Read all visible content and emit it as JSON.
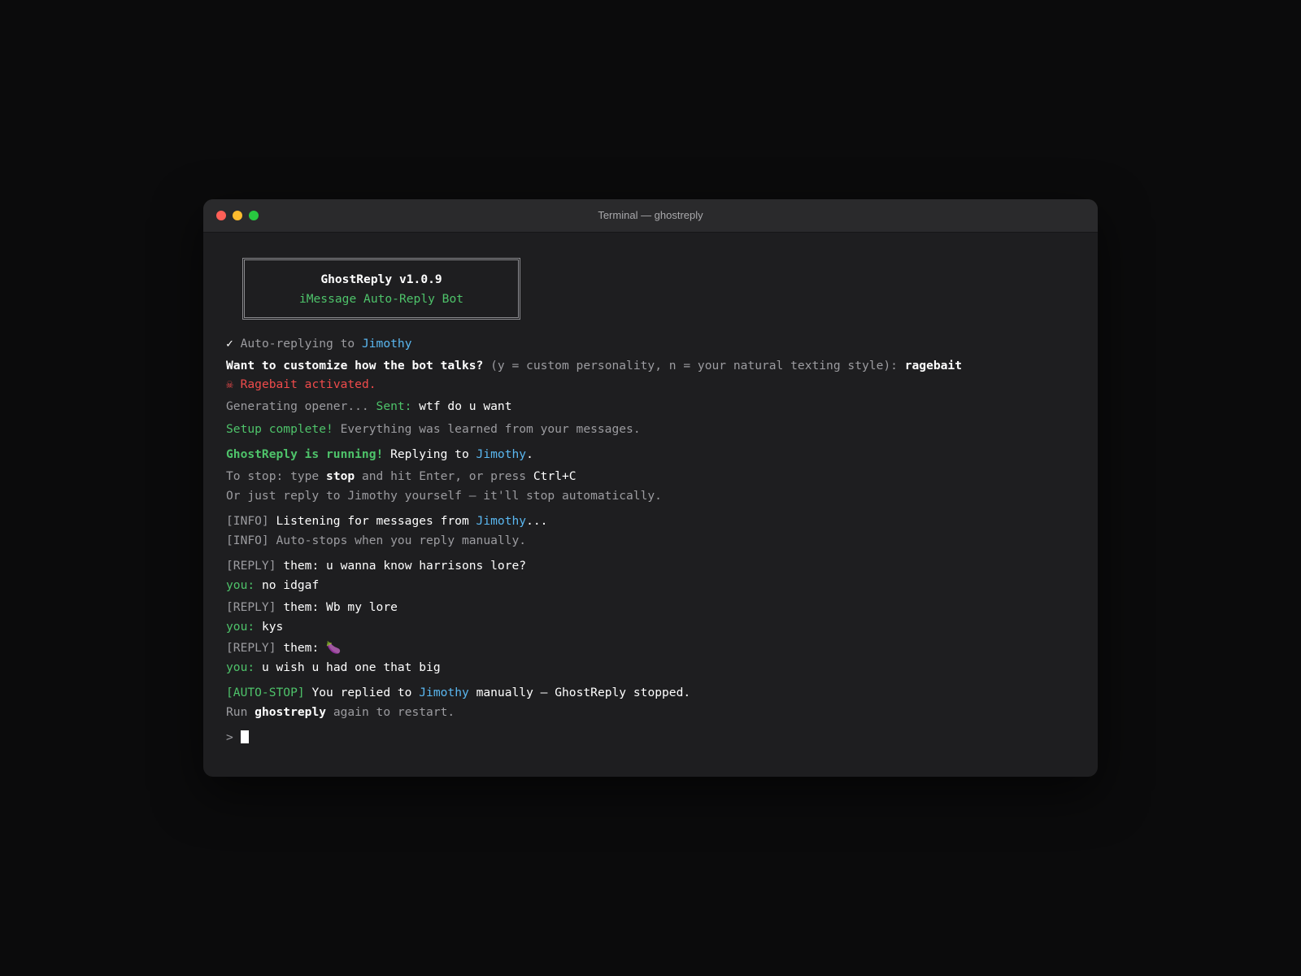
{
  "window": {
    "title": "Terminal — ghostreply"
  },
  "banner": {
    "title": "GhostReply v1.0.9",
    "subtitle": "iMessage Auto-Reply Bot"
  },
  "status": {
    "check": "✓",
    "auto_replying": "Auto-replying to",
    "contact": "Jimothy"
  },
  "prompt": {
    "question": "Want to customize how the bot talks?",
    "options": "(y = custom personality, n = your natural texting style):",
    "answer": "ragebait"
  },
  "ragebait": {
    "icon": "☠",
    "text": "Ragebait activated."
  },
  "opener": {
    "generating": "Generating opener...",
    "sent_label": "Sent:",
    "sent_text": "wtf do u want"
  },
  "setup": {
    "complete": "Setup complete!",
    "detail": "Everything was learned from your messages."
  },
  "running": {
    "label": "GhostReply is running!",
    "replying": "Replying to",
    "contact": "Jimothy",
    "period": "."
  },
  "stop_info": {
    "prefix": "To stop: type",
    "stop_word": "stop",
    "middle": "and hit Enter, or press",
    "shortcut": "Ctrl+C",
    "line2": "Or just reply to Jimothy yourself — it'll stop automatically."
  },
  "info": {
    "tag": "[INFO]",
    "listening": "Listening for messages from",
    "contact": "Jimothy",
    "ellipsis": "...",
    "autostop": "Auto-stops when you reply manually."
  },
  "conversation": [
    {
      "tag": "[REPLY]",
      "them_label": "them:",
      "them": "u wanna know harrisons lore?",
      "you_label": "you:",
      "you": "no idgaf"
    },
    {
      "tag": "[REPLY]",
      "them_label": "them:",
      "them": "Wb my lore",
      "you_label": "you:",
      "you": "kys"
    },
    {
      "tag": "[REPLY]",
      "them_label": "them:",
      "them": "🍆",
      "you_label": "you:",
      "you": "u wish u had one that big"
    }
  ],
  "autostop": {
    "tag": "[AUTO-STOP]",
    "prefix": "You replied to",
    "contact": "Jimothy",
    "suffix": "manually — GhostReply stopped.",
    "run": "Run",
    "command": "ghostreply",
    "restart": "again to restart."
  },
  "shell": {
    "prompt": ">"
  },
  "colors": {
    "background": "#0b0b0c",
    "window": "#1e1e20",
    "green": "#4ec36a",
    "blue": "#5ab7f0",
    "red": "#ef4b4b",
    "gray": "#9c9ca0"
  }
}
